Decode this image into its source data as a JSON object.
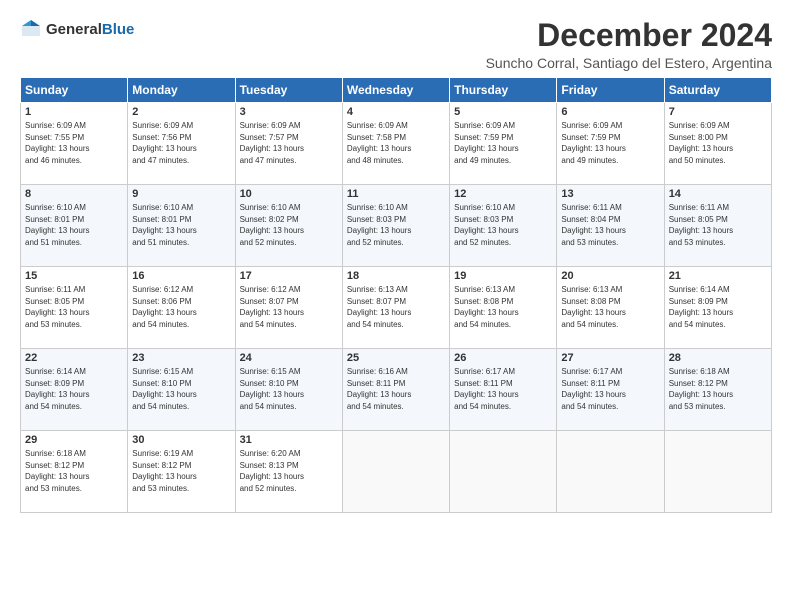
{
  "logo": {
    "general": "General",
    "blue": "Blue"
  },
  "title": "December 2024",
  "subtitle": "Suncho Corral, Santiago del Estero, Argentina",
  "headers": [
    "Sunday",
    "Monday",
    "Tuesday",
    "Wednesday",
    "Thursday",
    "Friday",
    "Saturday"
  ],
  "weeks": [
    [
      {
        "day": "1",
        "info": "Sunrise: 6:09 AM\nSunset: 7:55 PM\nDaylight: 13 hours\nand 46 minutes."
      },
      {
        "day": "2",
        "info": "Sunrise: 6:09 AM\nSunset: 7:56 PM\nDaylight: 13 hours\nand 47 minutes."
      },
      {
        "day": "3",
        "info": "Sunrise: 6:09 AM\nSunset: 7:57 PM\nDaylight: 13 hours\nand 47 minutes."
      },
      {
        "day": "4",
        "info": "Sunrise: 6:09 AM\nSunset: 7:58 PM\nDaylight: 13 hours\nand 48 minutes."
      },
      {
        "day": "5",
        "info": "Sunrise: 6:09 AM\nSunset: 7:59 PM\nDaylight: 13 hours\nand 49 minutes."
      },
      {
        "day": "6",
        "info": "Sunrise: 6:09 AM\nSunset: 7:59 PM\nDaylight: 13 hours\nand 49 minutes."
      },
      {
        "day": "7",
        "info": "Sunrise: 6:09 AM\nSunset: 8:00 PM\nDaylight: 13 hours\nand 50 minutes."
      }
    ],
    [
      {
        "day": "8",
        "info": "Sunrise: 6:10 AM\nSunset: 8:01 PM\nDaylight: 13 hours\nand 51 minutes."
      },
      {
        "day": "9",
        "info": "Sunrise: 6:10 AM\nSunset: 8:01 PM\nDaylight: 13 hours\nand 51 minutes."
      },
      {
        "day": "10",
        "info": "Sunrise: 6:10 AM\nSunset: 8:02 PM\nDaylight: 13 hours\nand 52 minutes."
      },
      {
        "day": "11",
        "info": "Sunrise: 6:10 AM\nSunset: 8:03 PM\nDaylight: 13 hours\nand 52 minutes."
      },
      {
        "day": "12",
        "info": "Sunrise: 6:10 AM\nSunset: 8:03 PM\nDaylight: 13 hours\nand 52 minutes."
      },
      {
        "day": "13",
        "info": "Sunrise: 6:11 AM\nSunset: 8:04 PM\nDaylight: 13 hours\nand 53 minutes."
      },
      {
        "day": "14",
        "info": "Sunrise: 6:11 AM\nSunset: 8:05 PM\nDaylight: 13 hours\nand 53 minutes."
      }
    ],
    [
      {
        "day": "15",
        "info": "Sunrise: 6:11 AM\nSunset: 8:05 PM\nDaylight: 13 hours\nand 53 minutes."
      },
      {
        "day": "16",
        "info": "Sunrise: 6:12 AM\nSunset: 8:06 PM\nDaylight: 13 hours\nand 54 minutes."
      },
      {
        "day": "17",
        "info": "Sunrise: 6:12 AM\nSunset: 8:07 PM\nDaylight: 13 hours\nand 54 minutes."
      },
      {
        "day": "18",
        "info": "Sunrise: 6:13 AM\nSunset: 8:07 PM\nDaylight: 13 hours\nand 54 minutes."
      },
      {
        "day": "19",
        "info": "Sunrise: 6:13 AM\nSunset: 8:08 PM\nDaylight: 13 hours\nand 54 minutes."
      },
      {
        "day": "20",
        "info": "Sunrise: 6:13 AM\nSunset: 8:08 PM\nDaylight: 13 hours\nand 54 minutes."
      },
      {
        "day": "21",
        "info": "Sunrise: 6:14 AM\nSunset: 8:09 PM\nDaylight: 13 hours\nand 54 minutes."
      }
    ],
    [
      {
        "day": "22",
        "info": "Sunrise: 6:14 AM\nSunset: 8:09 PM\nDaylight: 13 hours\nand 54 minutes."
      },
      {
        "day": "23",
        "info": "Sunrise: 6:15 AM\nSunset: 8:10 PM\nDaylight: 13 hours\nand 54 minutes."
      },
      {
        "day": "24",
        "info": "Sunrise: 6:15 AM\nSunset: 8:10 PM\nDaylight: 13 hours\nand 54 minutes."
      },
      {
        "day": "25",
        "info": "Sunrise: 6:16 AM\nSunset: 8:11 PM\nDaylight: 13 hours\nand 54 minutes."
      },
      {
        "day": "26",
        "info": "Sunrise: 6:17 AM\nSunset: 8:11 PM\nDaylight: 13 hours\nand 54 minutes."
      },
      {
        "day": "27",
        "info": "Sunrise: 6:17 AM\nSunset: 8:11 PM\nDaylight: 13 hours\nand 54 minutes."
      },
      {
        "day": "28",
        "info": "Sunrise: 6:18 AM\nSunset: 8:12 PM\nDaylight: 13 hours\nand 53 minutes."
      }
    ],
    [
      {
        "day": "29",
        "info": "Sunrise: 6:18 AM\nSunset: 8:12 PM\nDaylight: 13 hours\nand 53 minutes."
      },
      {
        "day": "30",
        "info": "Sunrise: 6:19 AM\nSunset: 8:12 PM\nDaylight: 13 hours\nand 53 minutes."
      },
      {
        "day": "31",
        "info": "Sunrise: 6:20 AM\nSunset: 8:13 PM\nDaylight: 13 hours\nand 52 minutes."
      },
      {
        "day": "",
        "info": ""
      },
      {
        "day": "",
        "info": ""
      },
      {
        "day": "",
        "info": ""
      },
      {
        "day": "",
        "info": ""
      }
    ]
  ]
}
